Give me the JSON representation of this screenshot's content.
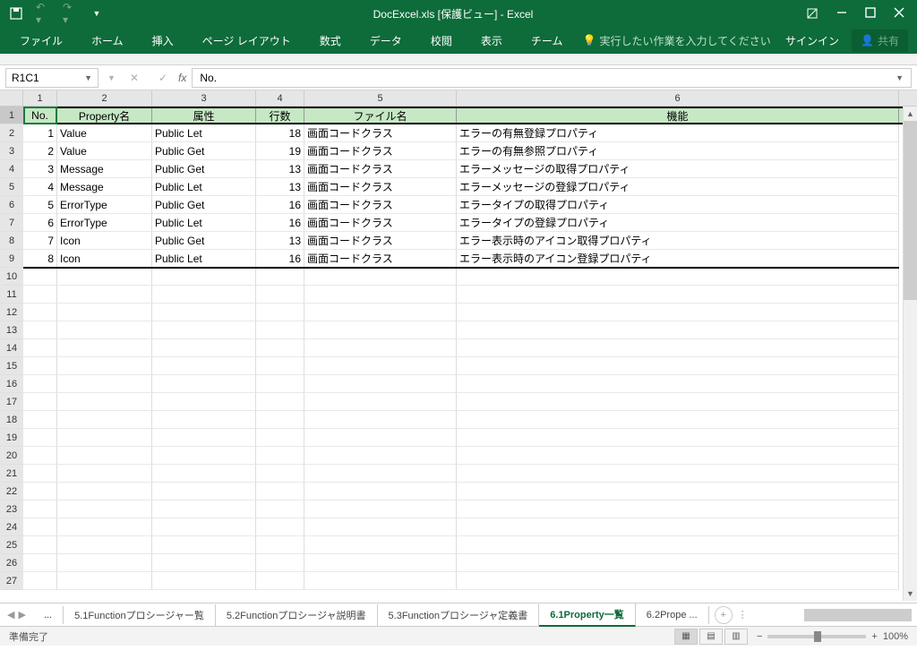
{
  "titlebar": {
    "title": "DocExcel.xls [保護ビュー] - Excel"
  },
  "ribbon": {
    "tabs": [
      "ファイル",
      "ホーム",
      "挿入",
      "ページ レイアウト",
      "数式",
      "データ",
      "校閲",
      "表示",
      "チーム"
    ],
    "search_placeholder": "実行したい作業を入力してください",
    "signin": "サインイン",
    "share": "共有"
  },
  "formula_bar": {
    "name_box": "R1C1",
    "formula": "No."
  },
  "columns": [
    "1",
    "2",
    "3",
    "4",
    "5",
    "6"
  ],
  "headers": [
    "No.",
    "Property名",
    "属性",
    "行数",
    "ファイル名",
    "機能"
  ],
  "rows": [
    {
      "no": "1",
      "prop": "Value",
      "attr": "Public Let",
      "lines": "18",
      "file": "画面コードクラス",
      "func": "エラーの有無登録プロパティ"
    },
    {
      "no": "2",
      "prop": "Value",
      "attr": "Public Get",
      "lines": "19",
      "file": "画面コードクラス",
      "func": "エラーの有無参照プロパティ"
    },
    {
      "no": "3",
      "prop": "Message",
      "attr": "Public Get",
      "lines": "13",
      "file": "画面コードクラス",
      "func": "エラーメッセージの取得プロパティ"
    },
    {
      "no": "4",
      "prop": "Message",
      "attr": "Public Let",
      "lines": "13",
      "file": "画面コードクラス",
      "func": "エラーメッセージの登録プロパティ"
    },
    {
      "no": "5",
      "prop": "ErrorType",
      "attr": "Public Get",
      "lines": "16",
      "file": "画面コードクラス",
      "func": "エラータイプの取得プロパティ"
    },
    {
      "no": "6",
      "prop": "ErrorType",
      "attr": "Public Let",
      "lines": "16",
      "file": "画面コードクラス",
      "func": "エラータイプの登録プロパティ"
    },
    {
      "no": "7",
      "prop": "Icon",
      "attr": "Public Get",
      "lines": "13",
      "file": "画面コードクラス",
      "func": "エラー表示時のアイコン取得プロパティ"
    },
    {
      "no": "8",
      "prop": "Icon",
      "attr": "Public Let",
      "lines": "16",
      "file": "画面コードクラス",
      "func": "エラー表示時のアイコン登録プロパティ"
    }
  ],
  "sheet_tabs": {
    "ellipsis": "...",
    "tabs": [
      "5.1Functionプロシージャー覧",
      "5.2Functionプロシージャ説明書",
      "5.3Functionプロシージャ定義書",
      "6.1Property一覧",
      "6.2Prope ..."
    ],
    "active_index": 3
  },
  "status": {
    "text": "準備完了",
    "zoom": "100%"
  },
  "row_count": 27
}
